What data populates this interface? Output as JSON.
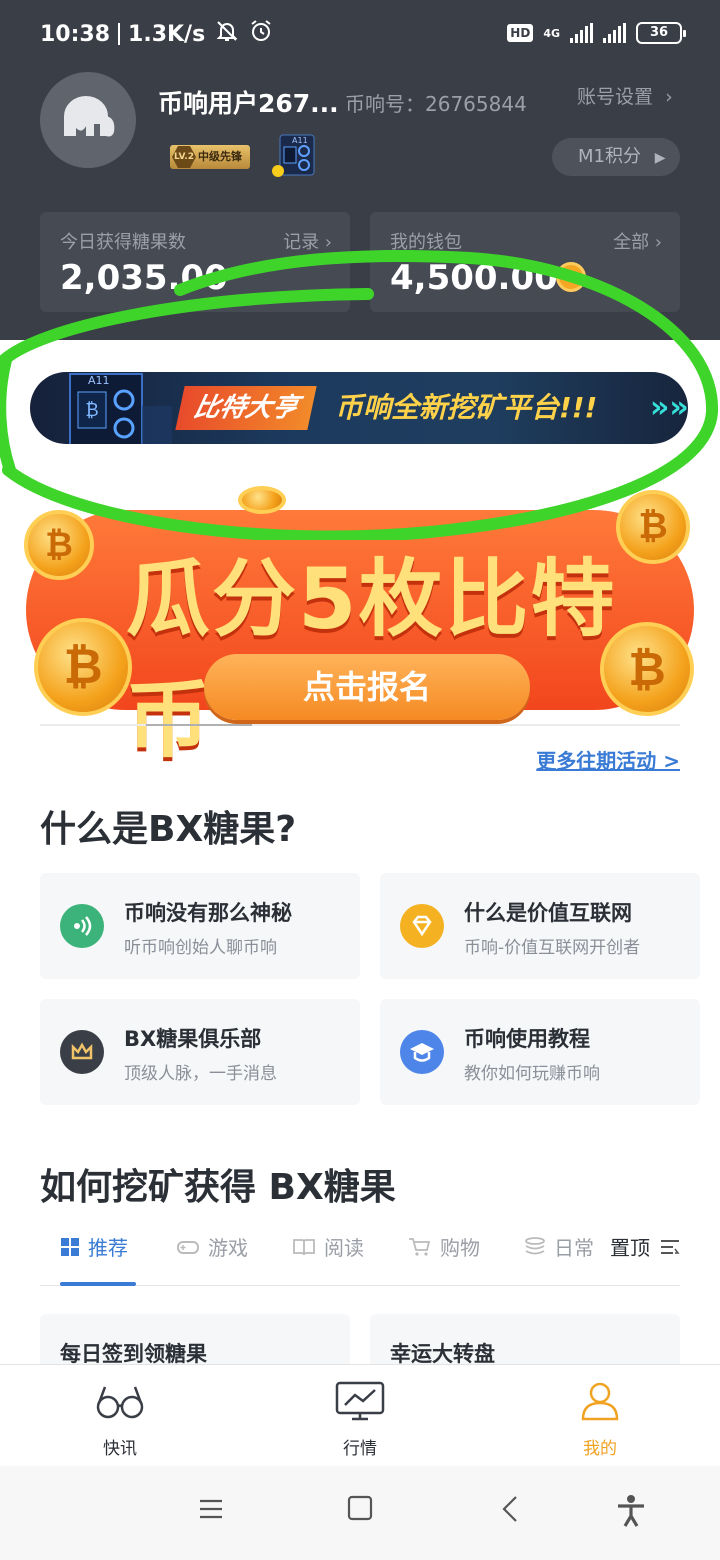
{
  "status_bar": {
    "time": "10:38",
    "speed": "1.3K/s",
    "hd": "HD",
    "network": "4G",
    "battery": "36"
  },
  "profile": {
    "username": "币响用户267...",
    "user_id": "币响号：26765844",
    "account_settings": "账号设置",
    "level_badge": "LV.2",
    "level_title": "中级先锋",
    "machine_badge": "A11",
    "points_button": "M1积分"
  },
  "stats": {
    "today": {
      "label": "今日获得糖果数",
      "link": "记录",
      "value": "2,035.00"
    },
    "wallet": {
      "label": "我的钱包",
      "link": "全部",
      "value": "4,500.00"
    }
  },
  "banner_top": {
    "machine": "A11",
    "tag": "比特大亨",
    "slogan": "币响全新挖矿平台!!!",
    "arrows": "»»"
  },
  "banner_main": {
    "title": "瓜分5枚比特币",
    "cta": "点击报名"
  },
  "more_link": "更多往期活动 >",
  "section1": {
    "title": "什么是BX糖果?",
    "cards": [
      {
        "title": "币响没有那么神秘",
        "subtitle": "听币响创始人聊币响"
      },
      {
        "title": "什么是价值互联网",
        "subtitle": "币响-价值互联网开创者"
      },
      {
        "title": "BX糖果俱乐部",
        "subtitle": "顶级人脉，一手消息"
      },
      {
        "title": "币响使用教程",
        "subtitle": "教你如何玩赚币响"
      }
    ]
  },
  "section2": {
    "title": "如何挖矿获得 BX糖果",
    "tabs": [
      "推荐",
      "游戏",
      "阅读",
      "购物",
      "日常"
    ],
    "pin": "置顶",
    "cards": [
      "每日签到领糖果",
      "幸运大转盘"
    ]
  },
  "bottom_nav": [
    "快讯",
    "行情",
    "我的"
  ],
  "colors": {
    "header_bg": "#3a3e46",
    "accent_blue": "#3a7bd5",
    "accent_orange": "#f0a322",
    "highlight_green": "#3ed42a"
  }
}
